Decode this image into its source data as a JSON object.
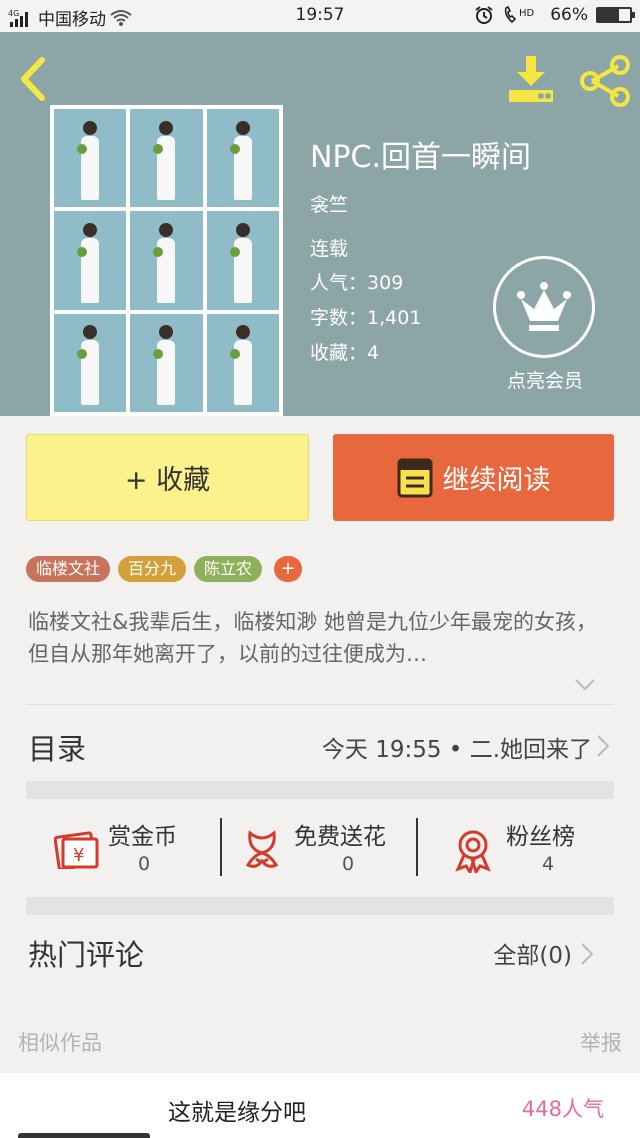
{
  "status": {
    "network_badge": "4G",
    "carrier": "中国移动",
    "time": "19:57",
    "hd_badge": "HD",
    "battery": "66%",
    "battery_level": 0.66
  },
  "book": {
    "title": "NPC.回首一瞬间",
    "author": "衾竺",
    "status": "连载",
    "popularity_label": "人气：",
    "popularity": "309",
    "words_label": "字数：",
    "words": "1,401",
    "favorites_label": "收藏：",
    "favorites": "4"
  },
  "vip_label": "点亮会员",
  "actions": {
    "favorite": "+ 收藏",
    "read": "继续阅读"
  },
  "tags": [
    {
      "label": "临楼文社",
      "color": "#c8735c"
    },
    {
      "label": "百分九",
      "color": "#d4a03c"
    },
    {
      "label": "陈立农",
      "color": "#8fb05a"
    }
  ],
  "tag_more": "+",
  "description": "临楼文社&我辈后生，临楼知渺 她曾是九位少年最宠的女孩，但自从那年她离开了，以前的过往便成为…",
  "toc": {
    "title": "目录",
    "latest": "今天 19:55 • 二.她回来了"
  },
  "stats": [
    {
      "label": "赏金币",
      "value": "0",
      "icon": "red-envelope-icon"
    },
    {
      "label": "免费送花",
      "value": "0",
      "icon": "flower-icon"
    },
    {
      "label": "粉丝榜",
      "value": "4",
      "icon": "medal-icon"
    }
  ],
  "comments": {
    "title": "热门评论",
    "all": "全部(0)"
  },
  "similar": {
    "title": "相似作品",
    "report": "举报"
  },
  "recommendation": {
    "title": "这就是缘分吧",
    "popularity": "448人气"
  },
  "colors": {
    "header_bg": "#8ca6a7",
    "icon_yellow": "#f5e642",
    "accent_orange": "#e8673c",
    "fav_yellow": "#fbf28b"
  }
}
